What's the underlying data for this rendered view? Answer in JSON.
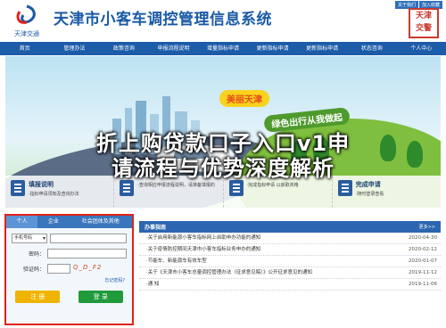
{
  "header": {
    "logo_text": "天津交通",
    "site_title": "天津市小客车调控管理信息系统",
    "top_links": [
      "关于我们",
      "加入收藏"
    ],
    "seal_text": "天津 交警 政务"
  },
  "nav": {
    "items": [
      "首页",
      "管理办法",
      "政策咨询",
      "申报流程说明",
      "增量指标申请",
      "更新指标申请",
      "更新指标申请",
      "状态咨询",
      "个人中心"
    ]
  },
  "banner": {
    "slogan_1": "美丽天津",
    "slogan_2": "绿色出行从我做起"
  },
  "overlay": {
    "line1": "折上购贷款口子入口v1申",
    "line2": "请流程与优势深度解析"
  },
  "notices": [
    {
      "title": "填报说明",
      "desc": "·指标申请须知及查询办法"
    },
    {
      "title": "",
      "desc": "·查询相应申报流程说明，请准备填报的"
    },
    {
      "title": "",
      "desc": "·完成指标申请 以获取资格"
    },
    {
      "title": "完成申请",
      "desc": "·随时登录查看"
    }
  ],
  "login": {
    "tabs": [
      "个人",
      "企业",
      "社会团体及其他"
    ],
    "id_type_label": "手机号码",
    "password_label": "密码：",
    "captcha_label": "验证码：",
    "captcha_text": "Q_D_F2",
    "forgot_label": "忘记密码?",
    "register_label": "注 册",
    "login_label": "登 录"
  },
  "guide": {
    "title": "办事指南",
    "more_label": "更多>>",
    "items": [
      {
        "title": "·关于启用新能源小客车指标网上自助申办功能的通知",
        "date": "2020-04-30"
      },
      {
        "title": "·关于疫情防控期间天津市小客车指标业务申办的通知",
        "date": "2020-02-12"
      },
      {
        "title": "·节能车、新能源车有效车型",
        "date": "2020-01-07"
      },
      {
        "title": "·关于《天津市小客车总量调控管理办法（征求意见稿）》公开征求意见的通知",
        "date": "2019-11-12"
      },
      {
        "title": "·通 知",
        "date": "2019-11-06"
      }
    ]
  },
  "colors": {
    "brand_blue": "#1c5ca8",
    "accent_red": "#e0221b",
    "register_orange": "#f0b400",
    "login_green": "#1f9b3b"
  }
}
